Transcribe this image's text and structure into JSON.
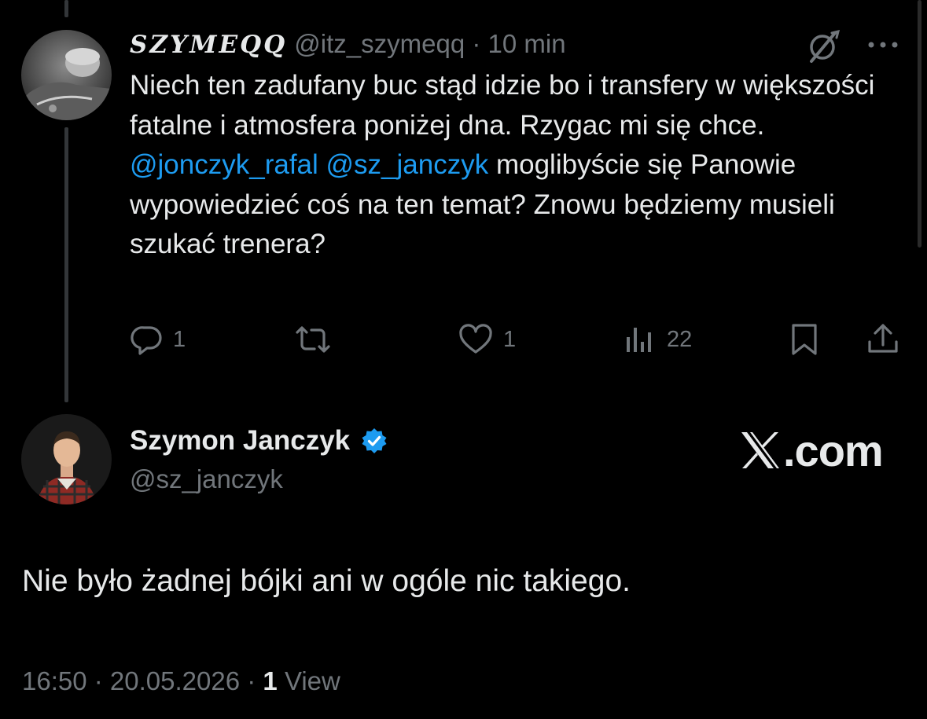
{
  "reply_tweet": {
    "display_name": "𝓢𝓩𝓨𝓜𝓔𝓠𝓠",
    "display_name_plain": "SZYMEQQ",
    "handle": "@itz_szymeqq",
    "separator": "·",
    "time": "10 min",
    "text_part1": "Niech ten zadufany buc stąd idzie bo i transfery w większości fatalne i atmosfera poniżej dna. Rzygac mi się chce.",
    "mention_1": "@jonczyk_rafal",
    "mention_2": "@sz_janczyk",
    "text_part2": "moglibyście się Panowie wypowiedzieć coś na ten temat? Znowu będziemy musieli szukać trenera?",
    "icons": {
      "grok": "grok-icon",
      "more": "more-icon"
    },
    "actions": {
      "reply_count": "1",
      "retweet_count": "",
      "like_count": "1",
      "views_count": "22"
    }
  },
  "main_tweet": {
    "display_name": "Szymon Janczyk",
    "verified": true,
    "handle": "@sz_janczyk",
    "watermark": ".com",
    "text": "Nie było żadnej bójki ani w ogóle nic takiego.",
    "timestamp": "16:50 · 20.05.2026 ·",
    "views_number": "1",
    "views_label": "View"
  },
  "colors": {
    "background": "#000000",
    "text": "#e7e9ea",
    "muted": "#71767b",
    "accent": "#1d9bf0",
    "thread_line": "#333639"
  }
}
